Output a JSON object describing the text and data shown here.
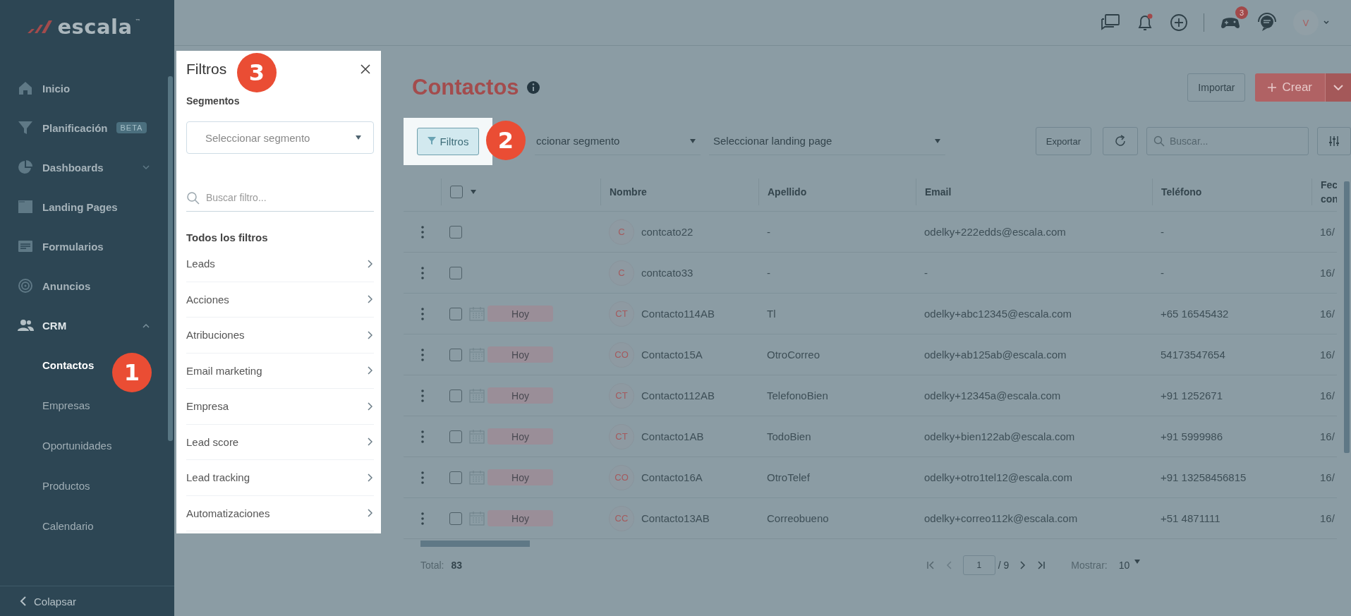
{
  "logo": {
    "text": "escala",
    "mark": "™"
  },
  "sidebar": {
    "items": [
      {
        "label": "Inicio",
        "selected": false
      },
      {
        "label": "Planificación",
        "badge": "BETA",
        "selected": false
      },
      {
        "label": "Dashboards",
        "expanded": false,
        "selected": false
      },
      {
        "label": "Landing Pages",
        "selected": false
      },
      {
        "label": "Formularios",
        "selected": false
      },
      {
        "label": "Anuncios",
        "selected": false
      },
      {
        "label": "CRM",
        "expanded": true,
        "selected": false,
        "children": [
          {
            "label": "Contactos",
            "selected": true
          },
          {
            "label": "Empresas",
            "selected": false
          },
          {
            "label": "Oportunidades",
            "selected": false
          },
          {
            "label": "Productos",
            "selected": false
          },
          {
            "label": "Calendario",
            "selected": false
          }
        ]
      }
    ],
    "collapse_label": "Colapsar"
  },
  "header": {
    "notification_dot": true,
    "games_badge": "3",
    "avatar": "V"
  },
  "filter_panel": {
    "title": "Filtros",
    "segments_label": "Segmentos",
    "segment_placeholder": "Seleccionar segmento",
    "search_placeholder": "Buscar filtro...",
    "all_label": "Todos los filtros",
    "items": [
      "Leads",
      "Acciones",
      "Atribuciones",
      "Email marketing",
      "Empresa",
      "Lead score",
      "Lead tracking",
      "Automatizaciones"
    ]
  },
  "page": {
    "title": "Contactos",
    "import_button": "Importar",
    "create_button": "Crear"
  },
  "toolbar": {
    "filter_button": "Filtros",
    "segment_select": "ccionar segmento",
    "landing_select": "Seleccionar landing page",
    "export_button": "Exportar",
    "search_placeholder": "Buscar..."
  },
  "table": {
    "select_all_checked": false,
    "columns": [
      "Nombre",
      "Apellido",
      "Email",
      "Teléfono",
      "Fec con"
    ],
    "rows": [
      {
        "checked": false,
        "initials": "C",
        "name": "contcato22",
        "last_name": "-",
        "email": "odelky+222edds@escala.com",
        "phone": "-",
        "date": "16/"
      },
      {
        "checked": false,
        "initials": "C",
        "name": "contcato33",
        "last_name": "-",
        "email": "-",
        "phone": "-",
        "date": "16/"
      },
      {
        "checked": false,
        "tag": "Hoy",
        "initials": "CT",
        "name": "Contacto114AB",
        "last_name": "Tl",
        "email": "odelky+abc12345@escala.com",
        "phone": "+65 16545432",
        "date": "16/"
      },
      {
        "checked": false,
        "tag": "Hoy",
        "initials": "CO",
        "name": "Contacto15A",
        "last_name": "OtroCorreo",
        "email": "odelky+ab125ab@escala.com",
        "phone": "54173547654",
        "date": "16/"
      },
      {
        "checked": false,
        "tag": "Hoy",
        "initials": "CT",
        "name": "Contacto112AB",
        "last_name": "TelefonoBien",
        "email": "odelky+12345a@escala.com",
        "phone": "+91 1252671",
        "date": "16/"
      },
      {
        "checked": false,
        "tag": "Hoy",
        "initials": "CT",
        "name": "Contacto1AB",
        "last_name": "TodoBien",
        "email": "odelky+bien122ab@escala.com",
        "phone": "+91 5999986",
        "date": "16/"
      },
      {
        "checked": false,
        "tag": "Hoy",
        "initials": "CO",
        "name": "Contacto16A",
        "last_name": "OtroTelef",
        "email": "odelky+otro1tel12@escala.com",
        "phone": "+91 13258456815",
        "date": "16/"
      },
      {
        "checked": false,
        "tag": "Hoy",
        "initials": "CC",
        "name": "Contacto13AB",
        "last_name": "Correobueno",
        "email": "odelky+correo112k@escala.com",
        "phone": "+51 4871111",
        "date": "16/"
      }
    ]
  },
  "footer": {
    "total_label": "Total:",
    "total": "83",
    "page": "1",
    "pages": "/ 9",
    "show_label": "Mostrar:",
    "show_value": "10"
  },
  "callouts": [
    "1",
    "2",
    "3"
  ]
}
